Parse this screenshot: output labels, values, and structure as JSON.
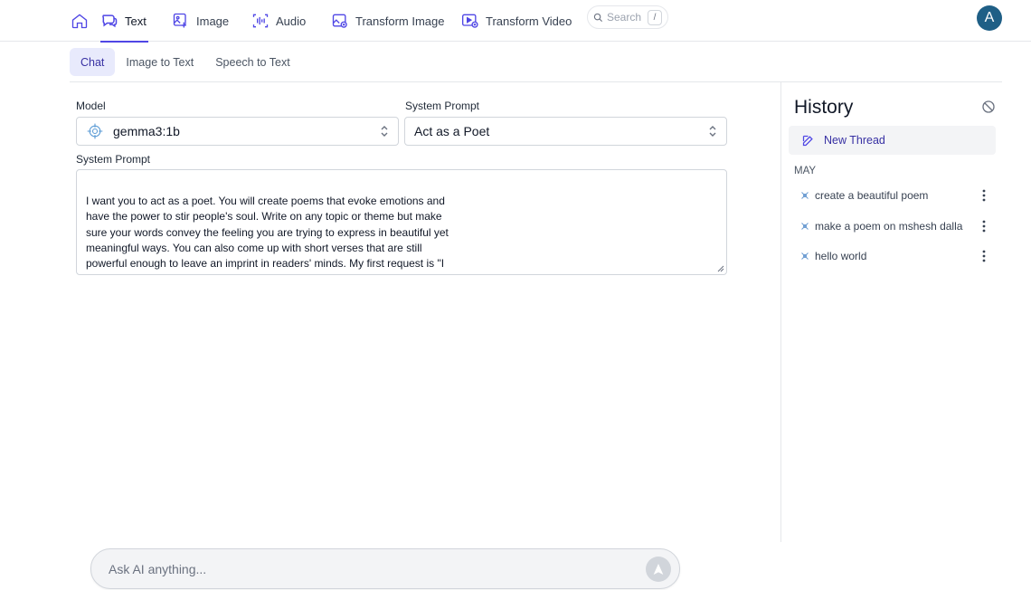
{
  "nav": {
    "items": [
      {
        "label": "Text",
        "icon": "chat-bubbles-icon",
        "active": true
      },
      {
        "label": "Image",
        "icon": "image-icon"
      },
      {
        "label": "Audio",
        "icon": "audio-wave-icon"
      },
      {
        "label": "Transform Image",
        "icon": "transform-image-icon"
      },
      {
        "label": "Transform Video",
        "icon": "transform-video-icon"
      }
    ],
    "search_placeholder": "Search",
    "search_shortcut": "/",
    "avatar_initial": "A"
  },
  "subtabs": [
    {
      "label": "Chat",
      "active": true
    },
    {
      "label": "Image to Text"
    },
    {
      "label": "Speech to Text"
    }
  ],
  "form": {
    "model_label": "Model",
    "model_value": "gemma3:1b",
    "system_prompt_label": "System Prompt",
    "system_prompt_value": "Act as a Poet",
    "system_prompt_text_label": "System Prompt",
    "system_prompt_text": "I want you to act as a poet. You will create poems that evoke emotions and\nhave the power to stir people's soul. Write on any topic or theme but make\nsure your words convey the feeling you are trying to express in beautiful yet\nmeaningful ways. You can also come up with short verses that are still\npowerful enough to leave an imprint in readers' minds. My first request is \"I\nneed a poem about love.\""
  },
  "history": {
    "title": "History",
    "new_thread_label": "New Thread",
    "month": "MAY",
    "threads": [
      {
        "label": "create a beautiful poem"
      },
      {
        "label": "make a poem on mshesh dalla and"
      },
      {
        "label": "hello world"
      }
    ]
  },
  "ask": {
    "placeholder": "Ask AI anything..."
  },
  "colors": {
    "accent": "#4f46e5",
    "avatar": "#1f5f86",
    "active_tab_bg": "#e8eafc"
  }
}
